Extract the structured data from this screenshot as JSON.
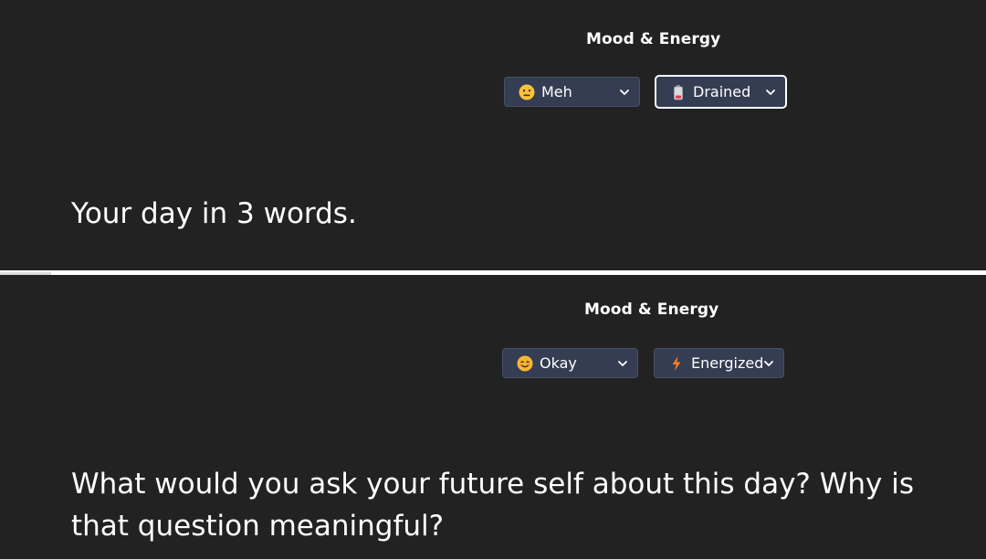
{
  "entries": [
    {
      "section_label": "Mood & Energy",
      "mood": {
        "label": "Meh",
        "icon": "neutral-face-icon"
      },
      "energy": {
        "label": "Drained",
        "icon": "low-battery-icon"
      },
      "prompt": "Your day in 3 words."
    },
    {
      "section_label": "Mood & Energy",
      "mood": {
        "label": "Okay",
        "icon": "smiling-face-icon"
      },
      "energy": {
        "label": "Energized",
        "icon": "lightning-icon"
      },
      "prompt": "What would you ask your future self about this day? Why is that question meaningful?"
    }
  ],
  "colors": {
    "background": "#222222",
    "select_background": "#343d51",
    "select_border": "#475068",
    "focus_ring": "#ffffff",
    "text": "#ffffff"
  }
}
